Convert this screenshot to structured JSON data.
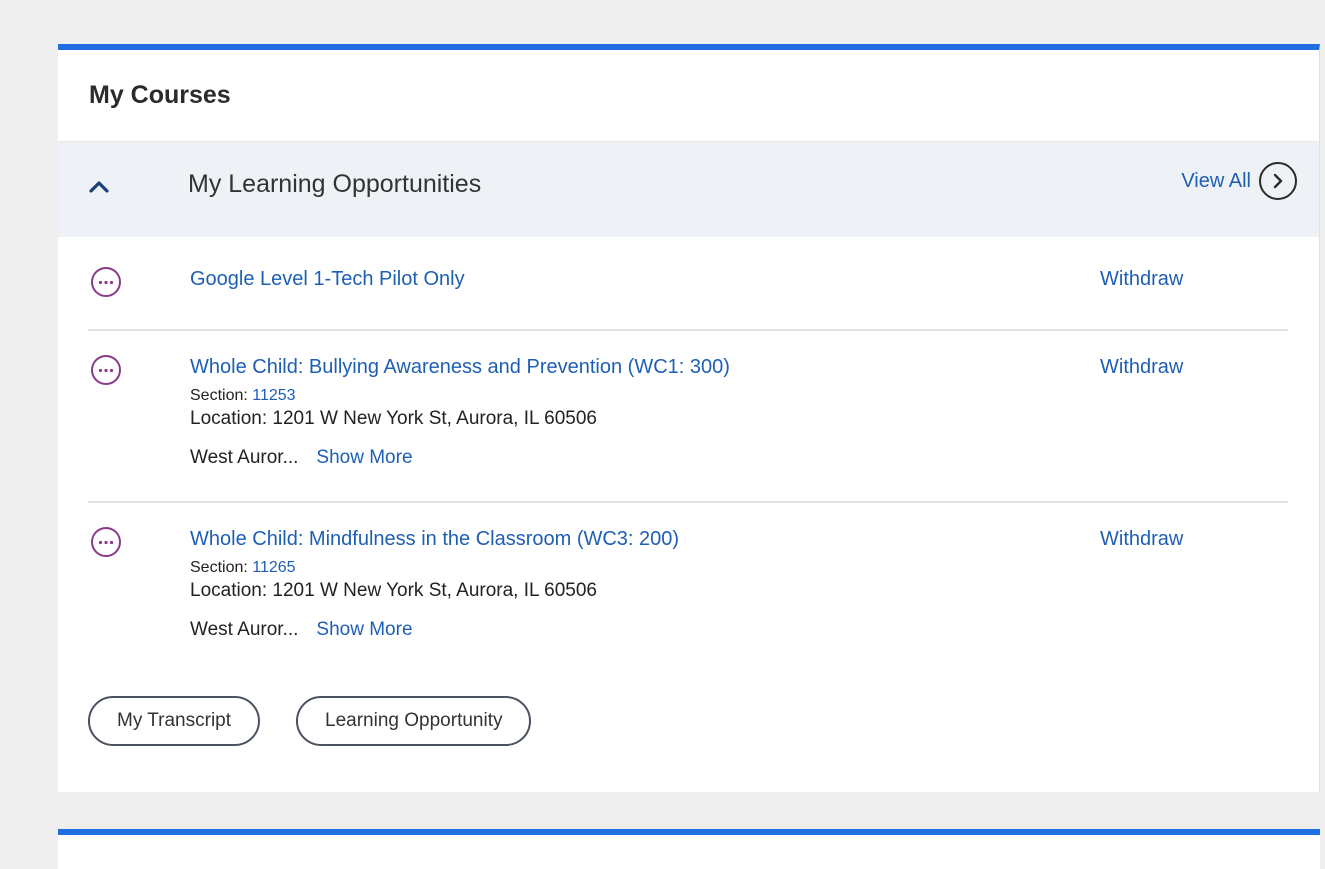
{
  "card": {
    "title": "My Courses",
    "accent_color": "#1f6fe0"
  },
  "section": {
    "title": "My Learning Opportunities",
    "collapse_icon": "chevron-up-icon",
    "view_all_label": "View All",
    "view_all_icon": "chevron-right-circle-icon"
  },
  "items": [
    {
      "title": "Google Level 1-Tech Pilot Only",
      "action": "Withdraw",
      "status_icon": "more-dots-icon"
    },
    {
      "title": "Whole Child: Bullying Awareness and Prevention (WC1: 300)",
      "action": "Withdraw",
      "section_label": "Section:",
      "section_number": "11253",
      "location": "Location: 1201 W New York St, Aurora, IL 60506",
      "org_truncated": "West Auror...",
      "show_more": "Show More",
      "status_icon": "more-dots-icon"
    },
    {
      "title": "Whole Child: Mindfulness in the Classroom (WC3: 200)",
      "action": "Withdraw",
      "section_label": "Section:",
      "section_number": "11265",
      "location": "Location: 1201 W New York St, Aurora, IL 60506",
      "org_truncated": "West Auror...",
      "show_more": "Show More",
      "status_icon": "more-dots-icon"
    }
  ],
  "buttons": {
    "transcript": "My Transcript",
    "learning_opportunity": "Learning Opportunity"
  },
  "colors": {
    "link": "#1e5fb4",
    "status_icon": "#8b3a8b",
    "section_bar_bg": "#eef2f6"
  }
}
